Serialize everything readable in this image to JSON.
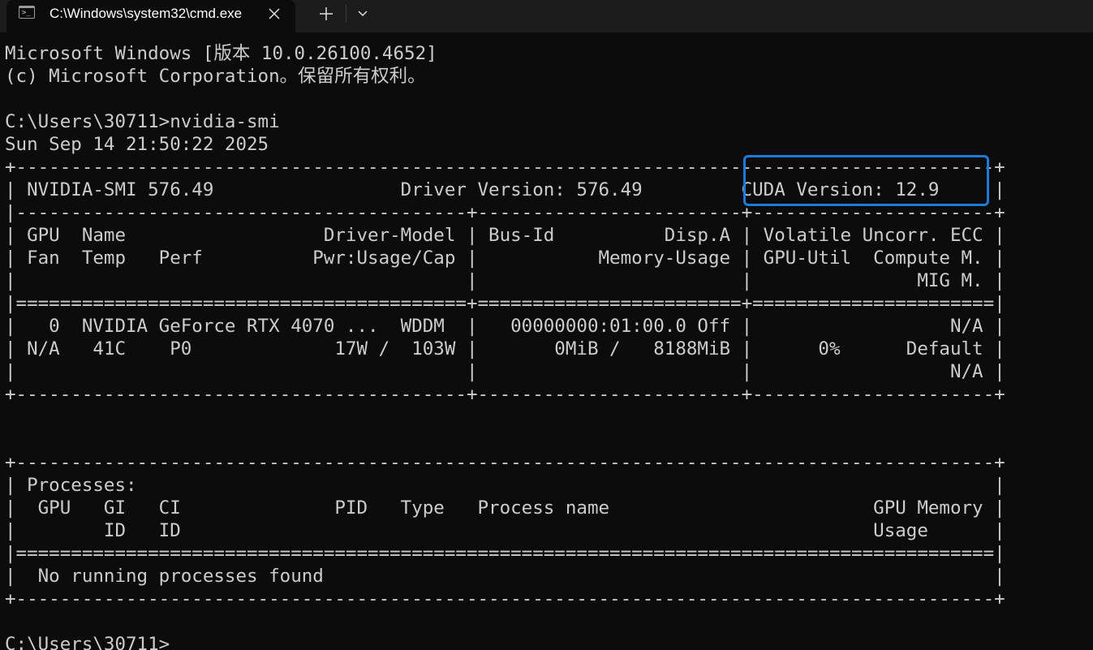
{
  "tab": {
    "title": "C:\\Windows\\system32\\cmd.exe",
    "icon": "console-icon"
  },
  "console": {
    "lines": [
      "Microsoft Windows [版本 10.0.26100.4652]",
      "(c) Microsoft Corporation。保留所有权利。",
      "",
      "C:\\Users\\30711>nvidia-smi",
      "Sun Sep 14 21:50:22 2025",
      "+-----------------------------------------------------------------------------------------+",
      "| NVIDIA-SMI 576.49                 Driver Version: 576.49         CUDA Version: 12.9     |",
      "|-----------------------------------------+------------------------+----------------------+",
      "| GPU  Name                  Driver-Model | Bus-Id          Disp.A | Volatile Uncorr. ECC |",
      "| Fan  Temp   Perf          Pwr:Usage/Cap |           Memory-Usage | GPU-Util  Compute M. |",
      "|                                         |                        |               MIG M. |",
      "|=========================================+========================+======================|",
      "|   0  NVIDIA GeForce RTX 4070 ...  WDDM  |   00000000:01:00.0 Off |                  N/A |",
      "| N/A   41C    P0             17W /  103W |       0MiB /   8188MiB |      0%      Default |",
      "|                                         |                        |                  N/A |",
      "+-----------------------------------------+------------------------+----------------------+",
      "",
      "",
      "+-----------------------------------------------------------------------------------------+",
      "| Processes:                                                                              |",
      "|  GPU   GI   CI              PID   Type   Process name                        GPU Memory |",
      "|        ID   ID                                                               Usage      |",
      "|=========================================================================================|",
      "|  No running processes found                                                             |",
      "+-----------------------------------------------------------------------------------------+",
      "",
      "C:\\Users\\30711>"
    ]
  },
  "annotation": {
    "color": "#1e7cd6"
  }
}
